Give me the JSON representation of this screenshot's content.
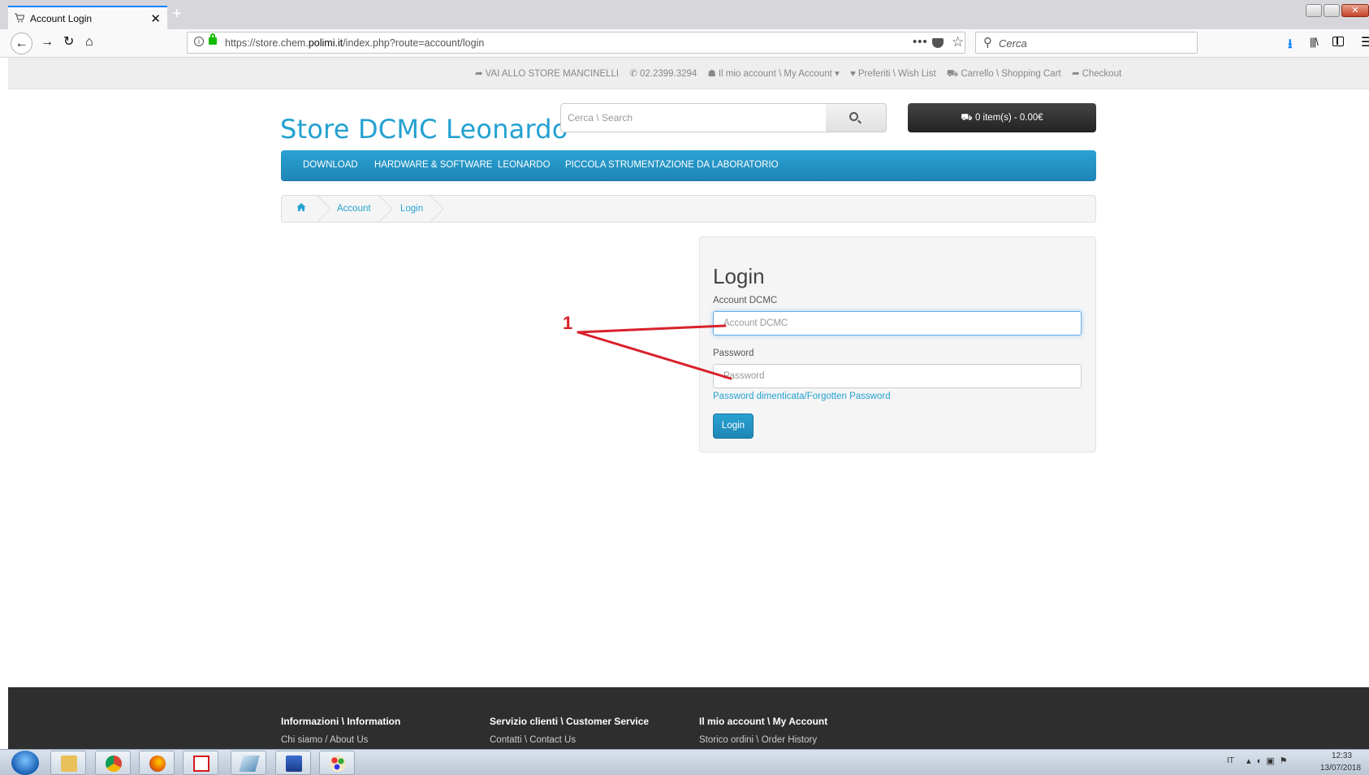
{
  "browser": {
    "tab_title": "Account Login",
    "url_prefix": "https://store.chem.",
    "url_domain": "polimi.it",
    "url_path": "/index.php?route=account/login",
    "search_placeholder": "Cerca",
    "page_actions": "•••"
  },
  "topbar": {
    "store_link": "VAI ALLO STORE MANCINELLI",
    "phone": "02.2399.3294",
    "account": "Il mio account \\ My Account",
    "wishlist": "Preferiti \\ Wish List",
    "cart": "Carrello \\ Shopping Cart",
    "checkout": "Checkout"
  },
  "header": {
    "logo": "Store DCMC Leonardo",
    "search_placeholder": "Cerca \\ Search",
    "cart_summary": "0 item(s) - 0.00€"
  },
  "menu": {
    "items": [
      "DOWNLOAD",
      "HARDWARE & SOFTWARE",
      "LEONARDO",
      "PICCOLA STRUMENTAZIONE DA LABORATORIO"
    ]
  },
  "breadcrumb": {
    "items": [
      "Account",
      "Login"
    ]
  },
  "login": {
    "title": "Login",
    "account_label": "Account DCMC",
    "account_placeholder": "Account DCMC",
    "password_label": "Password",
    "password_placeholder": "Password",
    "forgot": "Password dimenticata/Forgotten Password",
    "button": "Login"
  },
  "annotation": {
    "number": "1",
    "color": "#d8212b"
  },
  "footer": {
    "columns": [
      {
        "heading": "Informazioni \\ Information",
        "link": "Chi siamo / About Us"
      },
      {
        "heading": "Servizio clienti \\ Customer Service",
        "link": "Contatti \\ Contact Us"
      },
      {
        "heading": "Il mio account \\ My Account",
        "link": "Storico ordini \\ Order History"
      }
    ]
  },
  "taskbar": {
    "lang": "IT",
    "time": "12:33",
    "date": "13/07/2018"
  },
  "colors": {
    "accent": "#23a1d1",
    "menu_bar": "#2aa2d3",
    "footer": "#2e2e2e"
  }
}
